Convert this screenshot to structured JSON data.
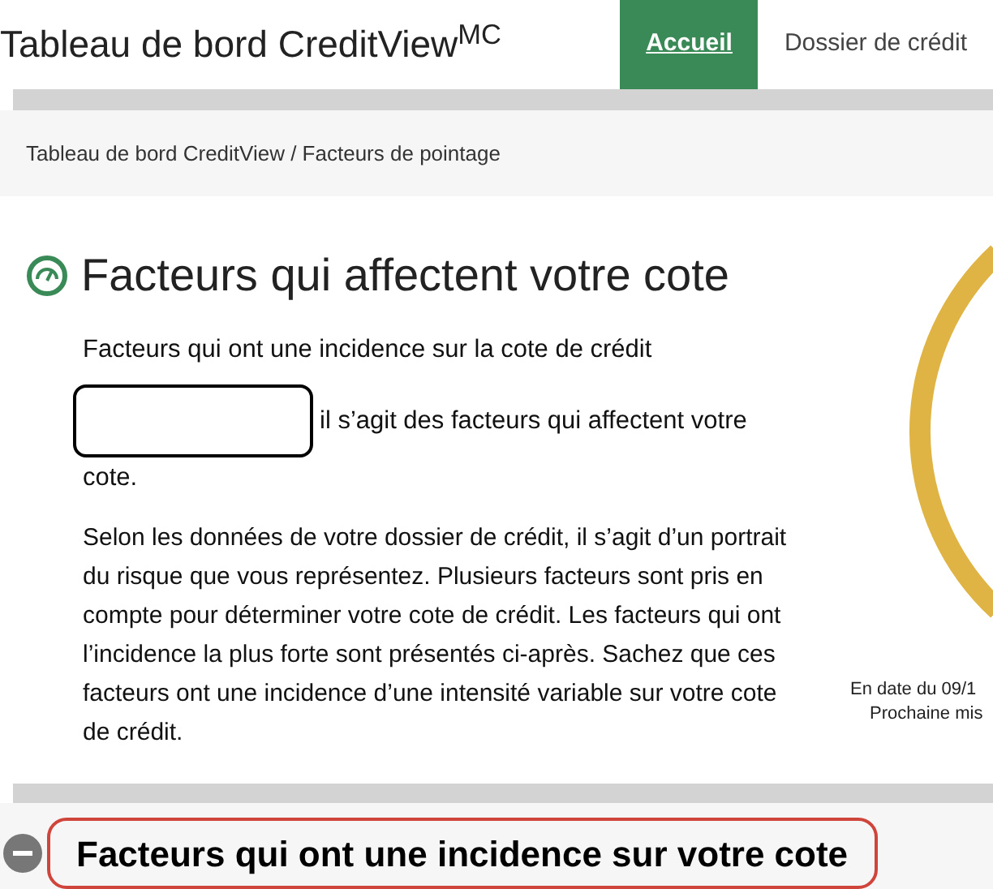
{
  "header": {
    "title": "Tableau de bord CreditView$^{MC}$",
    "nav": [
      {
        "label": "Accueil",
        "selected": true
      },
      {
        "label": "Dossier de crédit",
        "selected": false
      }
    ]
  },
  "breadcrumb": "Tableau de bord CreditView / Facteurs de pointage",
  "section": {
    "title": "Facteurs qui affectent votre cote",
    "subtitle": "Facteurs qui ont une incidence sur la cote de crédit",
    "intro": "il s’agit des facteurs qui affectent votre",
    "intro_end": "cote.",
    "body": "Selon les données de votre dossier de crédit, il s’agit d’un portrait du risque que vous représentez. Plusieurs facteurs sont pris en compte pour déterminer votre cote de crédit. Les facteurs qui ont l’incidence la plus forte sont présentés ci-après. Sachez que ces facteurs ont une incidence d’une intensité variable sur votre cote de crédit."
  },
  "gauge": {
    "date": "En date du 09/1",
    "next": "Prochaine mis"
  },
  "collapsible": {
    "title": "Facteurs qui ont une incidence sur votre cote",
    "expanded": true
  }
}
